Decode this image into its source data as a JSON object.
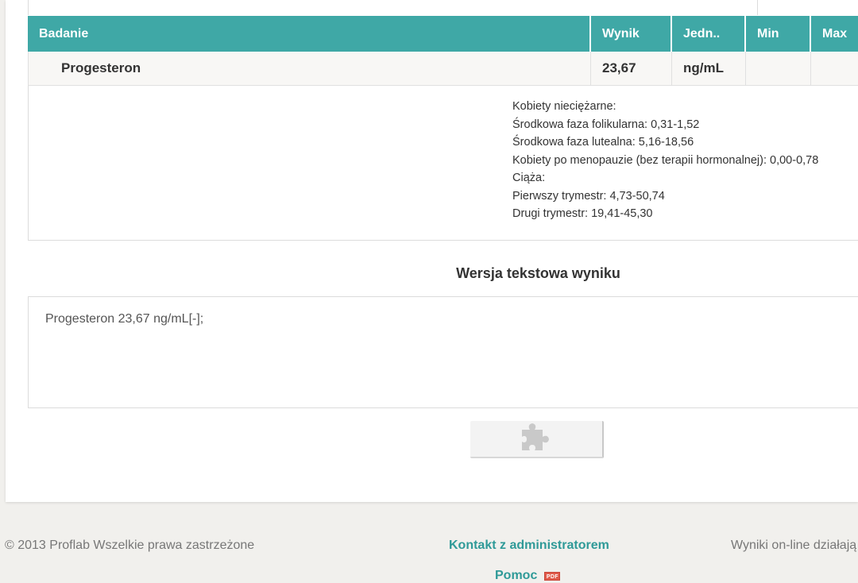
{
  "results_table": {
    "columns": [
      "Badanie",
      "Wynik",
      "Jedn..",
      "Min",
      "Max"
    ],
    "rows": [
      {
        "test": "Progesteron",
        "result": "23,67",
        "unit": "ng/mL",
        "min": "",
        "max": ""
      }
    ]
  },
  "reference_ranges": [
    "Kobiety nieciężarne:",
    "Środkowa faza folikularna: 0,31-1,52",
    "Środkowa faza lutealna: 5,16-18,56",
    "Kobiety po menopauzie (bez terapii hormonalnej): 0,00-0,78",
    "Ciąża:",
    "Pierwszy trymestr: 4,73-50,74",
    "Drugi trymestr: 19,41-45,30"
  ],
  "text_version": {
    "title": "Wersja tekstowa wyniku",
    "value": "Progesteron 23,67 ng/mL[-];"
  },
  "plugin_button": {
    "icon": "puzzle-piece-icon"
  },
  "footer": {
    "copyright": "© 2013 Proflab Wszelkie prawa zastrzeżone",
    "contact": "Kontakt z administratorem",
    "status": "Wyniki on-line działają",
    "help": "Pomoc",
    "help_icon_text": "PDF"
  },
  "colors": {
    "header_teal": "#3fa8a6",
    "link_teal": "#2f9a98",
    "pdf_red": "#e05b4b"
  }
}
